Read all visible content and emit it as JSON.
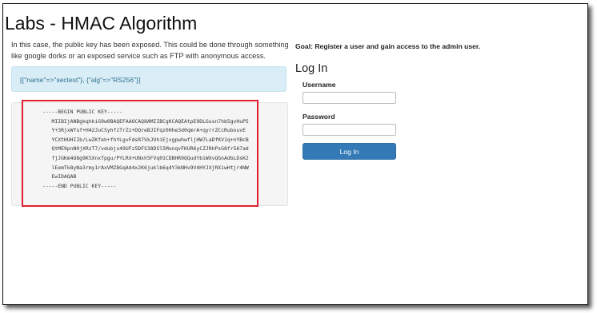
{
  "page": {
    "title": "Labs - HMAC Algorithm"
  },
  "intro": {
    "text": "In this case, the public key has been exposed. This could be done through something like google dorks or an exposed service such as FTP with anonymous access."
  },
  "alert": {
    "text": "[{\"name\"=>\"sectest\"}, {\"alg\"=>\"RS256\"}]"
  },
  "public_key": {
    "text": "-----BEGIN PUBLIC KEY-----\n   MIIBIjANBgkqhkiG9w0BAQEFAAOCAQ8AMIIBCgKCAQEAtpE9DLGusn7hb5gvHuP5\n   Y+3RjxWfsf+H42JuCSyhfzTrZz+DQreBJIFqz0Hhe3d0qmrA+qyrrZCcRubouvE\n   YCXtHUHIIb/LwZKfeh+fhYLgvFdsR7VkJUhiEjvgpwhwfljHW7LaDfKV1q+nYBcB\n   QtME9pnN0jXRzT7/vdubjs49UFz5DFS38DSl5MxnqvFKUR6yCZJRhPsG8fr5A7ad\n   fjJGKm4O8g9K5XnxTpgu/PYLRX+UNxh5FVq01CDBHR9QQudYbiWXvQGnAdbLDsK2\n   lEemTk8yNa3rmy1rAxVMZ8GqAd4x2K6juklb6q4Y3kNHv9V4HYJXjRXiwHtjr4NW\n   EwIDAQAB\n-----END PUBLIC KEY-----"
  },
  "goal": {
    "text": "Goal: Register a user and gain access to the admin user."
  },
  "login": {
    "heading": "Log In",
    "username_label": "Username",
    "username_value": "",
    "password_label": "Password",
    "password_value": "",
    "submit_label": "Log In"
  },
  "colors": {
    "alert_background": "#d9edf7",
    "alert_text": "#31708f",
    "primary_button": "#337ab7",
    "highlight_border": "#e0202a",
    "code_background": "#f5f5f5"
  }
}
